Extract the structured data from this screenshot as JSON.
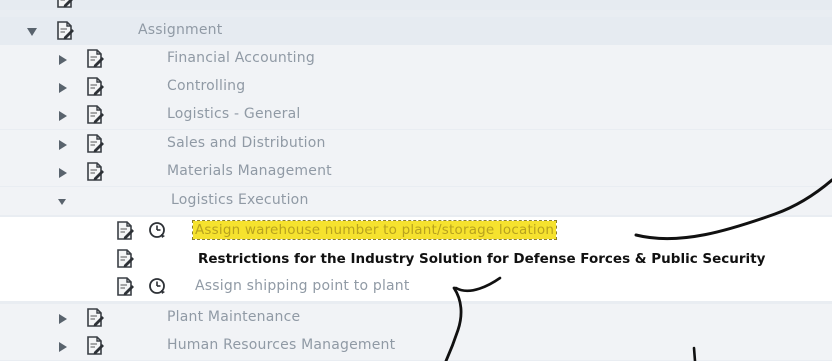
{
  "tree": {
    "root": {
      "label": "Assignment",
      "expanded": true
    },
    "items": [
      {
        "label": "Financial Accounting",
        "expanded": false
      },
      {
        "label": "Controlling",
        "expanded": false
      },
      {
        "label": "Logistics - General",
        "expanded": false
      },
      {
        "label": "Sales and Distribution",
        "expanded": false
      },
      {
        "label": "Materials Management",
        "expanded": false
      },
      {
        "label": "Logistics Execution",
        "expanded": true
      },
      {
        "label": "Plant Maintenance",
        "expanded": false
      },
      {
        "label": "Human Resources Management",
        "expanded": false
      }
    ],
    "logistics_execution_children": [
      {
        "label": "Assign warehouse number to plant/storage location",
        "selected": true,
        "has_clock": true
      },
      {
        "label": "Restrictions for the Industry Solution for Defense Forces & Public Security",
        "selected": false,
        "has_clock": false
      },
      {
        "label": "Assign shipping point to plant",
        "selected": false,
        "has_clock": true
      }
    ]
  },
  "icons": {
    "node": "document-edit-icon",
    "activity": "clock-icon",
    "collapsed": "triangle-right-icon",
    "expanded": "triangle-down-icon"
  },
  "colors": {
    "selection_highlight": "#f6e22e",
    "annotation_ink": "#111111"
  }
}
